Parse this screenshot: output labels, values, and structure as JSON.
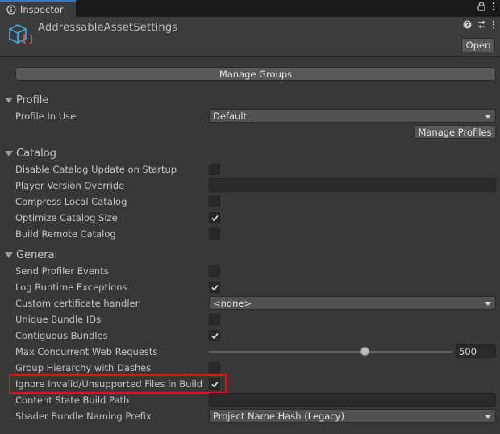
{
  "window": {
    "tab_label": "Inspector",
    "tab_icon": "info-icon",
    "controls": [
      "lock-icon",
      "kebab-menu-icon"
    ]
  },
  "header": {
    "asset_title": "AddressableAssetSettings",
    "asset_icon": "scriptable-object-icon",
    "icons": [
      "help-icon",
      "presets-icon",
      "kebab-menu-icon"
    ],
    "open_label": "Open"
  },
  "manage_groups_label": "Manage Groups",
  "profile": {
    "title": "Profile",
    "profile_in_use_label": "Profile In Use",
    "profile_in_use_value": "Default",
    "manage_profiles_label": "Manage Profiles"
  },
  "catalog": {
    "title": "Catalog",
    "disable_update_label": "Disable Catalog Update on Startup",
    "disable_update_checked": false,
    "player_version_label": "Player Version Override",
    "player_version_value": "",
    "compress_label": "Compress Local Catalog",
    "compress_checked": false,
    "optimize_label": "Optimize Catalog Size",
    "optimize_checked": true,
    "build_remote_label": "Build Remote Catalog",
    "build_remote_checked": false
  },
  "general": {
    "title": "General",
    "send_profiler_label": "Send Profiler Events",
    "send_profiler_checked": false,
    "log_runtime_label": "Log Runtime Exceptions",
    "log_runtime_checked": true,
    "cert_handler_label": "Custom certificate handler",
    "cert_handler_value": "<none>",
    "unique_ids_label": "Unique Bundle IDs",
    "unique_ids_checked": false,
    "contiguous_label": "Contiguous Bundles",
    "contiguous_checked": true,
    "max_web_label": "Max Concurrent Web Requests",
    "max_web_value": "500",
    "max_web_fraction": 0.5,
    "group_dashes_label": "Group Hierarchy with Dashes",
    "group_dashes_checked": false,
    "ignore_invalid_label": "Ignore Invalid/Unsupported Files in Build",
    "ignore_invalid_checked": true,
    "content_state_label": "Content State Build Path",
    "content_state_value": "",
    "shader_prefix_label": "Shader Bundle Naming Prefix",
    "shader_prefix_value": "Project Name Hash (Legacy)"
  },
  "colors": {
    "highlight": "#e11515",
    "tab_accent": "#3a79bb",
    "panel_bg": "#383838"
  }
}
